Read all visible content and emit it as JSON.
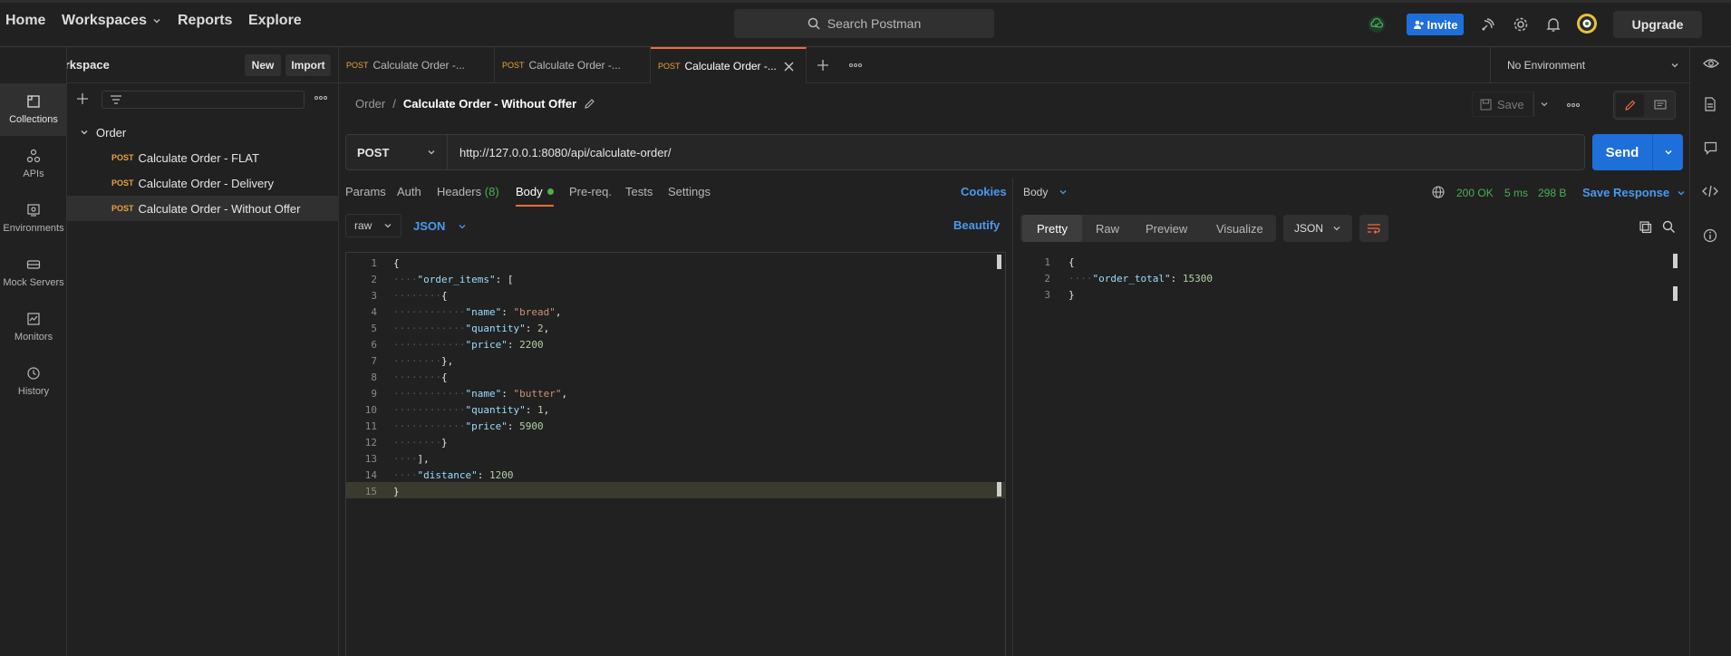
{
  "nav": {
    "home": "Home",
    "workspaces": "Workspaces",
    "reports": "Reports",
    "explore": "Explore"
  },
  "search": {
    "placeholder": "Search Postman"
  },
  "header_actions": {
    "invite": "Invite",
    "upgrade": "Upgrade"
  },
  "workspace": {
    "name": "My Workspace",
    "new_label": "New",
    "import_label": "Import"
  },
  "rail": [
    {
      "label": "Collections"
    },
    {
      "label": "APIs"
    },
    {
      "label": "Environments"
    },
    {
      "label": "Mock Servers"
    },
    {
      "label": "Monitors"
    },
    {
      "label": "History"
    }
  ],
  "collection": {
    "name": "Order",
    "requests": [
      {
        "method": "POST",
        "name": "Calculate Order - FLAT"
      },
      {
        "method": "POST",
        "name": "Calculate Order - Delivery"
      },
      {
        "method": "POST",
        "name": "Calculate Order - Without Offer"
      }
    ]
  },
  "tabs": [
    {
      "method": "POST",
      "label": "Calculate Order -..."
    },
    {
      "method": "POST",
      "label": "Calculate Order -..."
    },
    {
      "method": "POST",
      "label": "Calculate Order -..."
    }
  ],
  "environment": {
    "selected": "No Environment"
  },
  "breadcrumb": {
    "parent": "Order",
    "separator": "/",
    "current": "Calculate Order - Without Offer"
  },
  "request": {
    "save_label": "Save",
    "method": "POST",
    "url": "http://127.0.0.1:8080/api/calculate-order/",
    "send_label": "Send",
    "subtabs": {
      "params": "Params",
      "auth": "Auth",
      "headers": "Headers",
      "headers_count": "(8)",
      "body": "Body",
      "prereq": "Pre-req.",
      "tests": "Tests",
      "settings": "Settings",
      "cookies": "Cookies"
    },
    "body_type": "raw",
    "body_format": "JSON",
    "beautify_label": "Beautify"
  },
  "request_body_lines": [
    {
      "n": "1"
    },
    {
      "n": "2"
    },
    {
      "n": "3"
    },
    {
      "n": "4"
    },
    {
      "n": "5"
    },
    {
      "n": "6"
    },
    {
      "n": "7"
    },
    {
      "n": "8"
    },
    {
      "n": "9"
    },
    {
      "n": "10"
    },
    {
      "n": "11"
    },
    {
      "n": "12"
    },
    {
      "n": "13"
    },
    {
      "n": "14"
    },
    {
      "n": "15"
    }
  ],
  "request_body": {
    "k_order_items": "\"order_items\"",
    "k_name": "\"name\"",
    "k_quantity": "\"quantity\"",
    "k_price": "\"price\"",
    "k_distance": "\"distance\"",
    "v_bread": "\"bread\"",
    "v_q1": "2",
    "v_p1": "2200",
    "v_butter": "\"butter\"",
    "v_q2": "1",
    "v_p2": "5900",
    "v_distance": "1200"
  },
  "response": {
    "label": "Body",
    "status": "200 OK",
    "time": "5 ms",
    "size": "298 B",
    "save_response": "Save Response",
    "tabs": {
      "pretty": "Pretty",
      "raw": "Raw",
      "preview": "Preview",
      "visualize": "Visualize"
    },
    "format": "JSON",
    "line_numbers": [
      "1",
      "2",
      "3"
    ],
    "key": "\"order_total\"",
    "value": "15300"
  },
  "colors": {
    "accent": "#f26b3a",
    "primary": "#1f6fdb",
    "post": "#e8a33d",
    "success": "#4caf50"
  }
}
